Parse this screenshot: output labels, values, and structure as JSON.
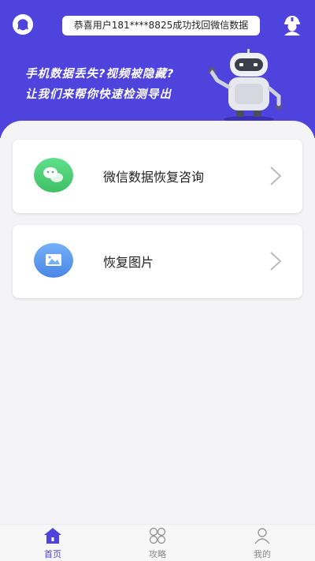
{
  "notice": {
    "text": "恭喜用户181****8825成功找回微信数据"
  },
  "banner": {
    "line1": "手机数据丢失?视频被隐藏?",
    "line2": "让我们来帮你快速检测导出"
  },
  "cards": [
    {
      "label": "微信数据恢复咨询",
      "icon": "wechat-icon",
      "color": "#4cd37a"
    },
    {
      "label": "恢复图片",
      "icon": "image-icon",
      "color": "#5a9cf0"
    }
  ],
  "tabs": [
    {
      "label": "首页",
      "icon": "home-icon",
      "active": true
    },
    {
      "label": "攻略",
      "icon": "grid-icon",
      "active": false
    },
    {
      "label": "我的",
      "icon": "user-icon",
      "active": false
    }
  ],
  "colors": {
    "primary": "#4f43de",
    "background": "#f4f4f6"
  }
}
